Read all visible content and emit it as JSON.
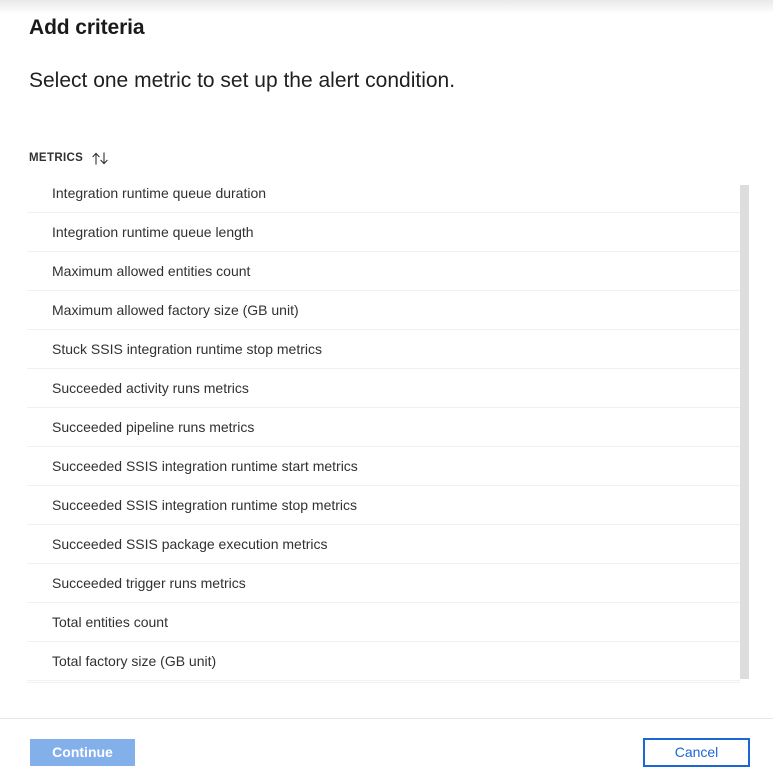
{
  "panel": {
    "title": "Add criteria",
    "subtitle": "Select one metric to set up the alert condition."
  },
  "list": {
    "column_header": "METRICS",
    "sort_icon": "sort-ascending-descending-icon",
    "metrics": [
      {
        "label": "Integration runtime queue duration"
      },
      {
        "label": "Integration runtime queue length"
      },
      {
        "label": "Maximum allowed entities count"
      },
      {
        "label": "Maximum allowed factory size (GB unit)"
      },
      {
        "label": "Stuck SSIS integration runtime stop metrics"
      },
      {
        "label": "Succeeded activity runs metrics"
      },
      {
        "label": "Succeeded pipeline runs metrics"
      },
      {
        "label": "Succeeded SSIS integration runtime start metrics"
      },
      {
        "label": "Succeeded SSIS integration runtime stop metrics"
      },
      {
        "label": "Succeeded SSIS package execution metrics"
      },
      {
        "label": "Succeeded trigger runs metrics"
      },
      {
        "label": "Total entities count"
      },
      {
        "label": "Total factory size (GB unit)"
      },
      {
        "label": ""
      }
    ]
  },
  "footer": {
    "continue_label": "Continue",
    "cancel_label": "Cancel"
  },
  "colors": {
    "continue_bg": "#83b0eb",
    "cancel_border": "#1b68d4",
    "cancel_text": "#1b68d4",
    "row_divider": "#f1f1f1",
    "scrollbar_thumb": "#dddddd",
    "text_primary": "#323130"
  }
}
